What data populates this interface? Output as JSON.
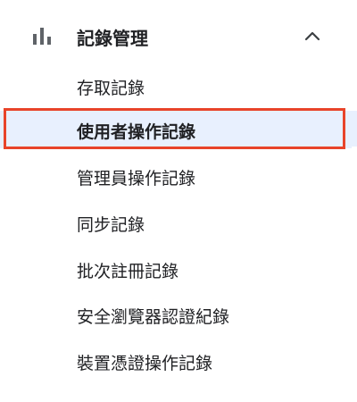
{
  "section": {
    "title": "記錄管理",
    "icon": "bar-chart-icon",
    "toggle_icon": "chevron-up-icon",
    "expanded": true
  },
  "items": [
    {
      "label": "存取記錄",
      "active": false
    },
    {
      "label": "使用者操作記錄",
      "active": true
    },
    {
      "label": "管理員操作記錄",
      "active": false
    },
    {
      "label": "同步記錄",
      "active": false
    },
    {
      "label": "批次註冊記錄",
      "active": false
    },
    {
      "label": "安全瀏覽器認證紀錄",
      "active": false
    },
    {
      "label": "裝置憑證操作記錄",
      "active": false
    }
  ],
  "colors": {
    "highlight_border": "#e8442a",
    "active_background": "#e8f0fe",
    "text": "#202124",
    "icon": "#5f6368"
  }
}
